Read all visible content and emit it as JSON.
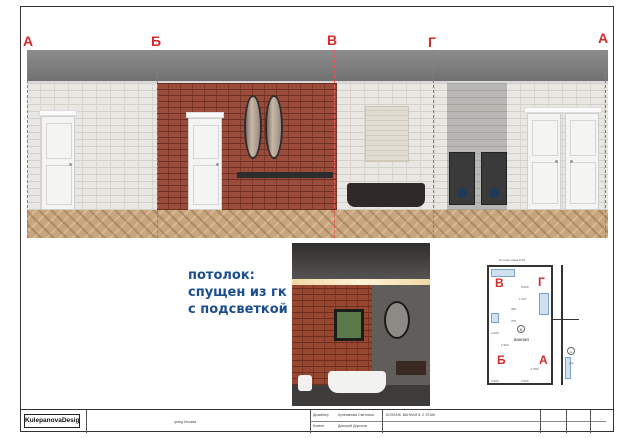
{
  "axes": {
    "labels": [
      "А",
      "Б",
      "В",
      "Г",
      "А"
    ]
  },
  "caption": {
    "line1": "потолок:",
    "line2": "спущен из гк",
    "line3": "с подсветкой"
  },
  "plan": {
    "labels": [
      "В",
      "Г",
      "Б",
      "А"
    ],
    "room_name": "ванная",
    "room_number": "8",
    "room_number_2": "1",
    "dims": [
      "1.247",
      "5.000",
      "1.900",
      "2.000",
      "2.000",
      "360",
      "375",
      "1.500",
      "4.200"
    ],
    "header_note": "Ж план этажа 8.20",
    "right_note": "кор."
  },
  "titleblock": {
    "logo": "KulepanovaDesign",
    "project": "гранд Москва",
    "role1": "Дизайнер",
    "name1": "Кулепанова Светлана",
    "role2": "Клиент",
    "name2": "Дмитрий Дорохов",
    "sheet_title": "КОЛЛАЖ. ВАННАЯ 8. 2 ЭТАЖ"
  },
  "colors": {
    "axis_red": "#d42a2a",
    "caption_blue": "#1c4e8e",
    "brick_red": "#9b4b39",
    "brick_white": "#e9e7e3",
    "ceiling_gray": "#7a7a7a",
    "floor_oak": "#c8a67d"
  }
}
